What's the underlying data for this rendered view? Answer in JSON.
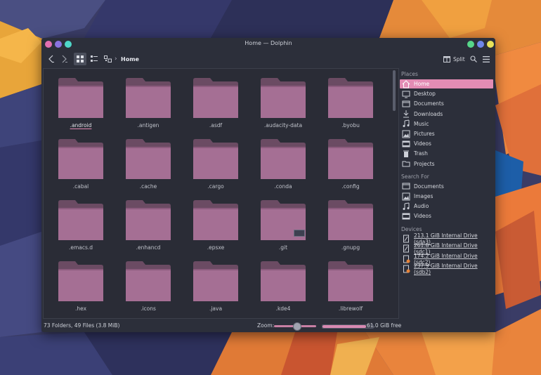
{
  "window": {
    "title": "Home — Dolphin"
  },
  "titlebar": {
    "left_buttons": [
      "#e26fb0",
      "#8a72e0",
      "#4fd6c8"
    ],
    "right_buttons": [
      "#57d68a",
      "#6f86ea",
      "#e8e25a"
    ]
  },
  "toolbar": {
    "back_icon": "chevron-left-icon",
    "forward_icon": "chevron-right-icon",
    "view_modes": [
      "icons-view-icon",
      "compact-view-icon",
      "details-view-icon"
    ],
    "breadcrumb": "Home",
    "split_label": "Split",
    "search_icon": "search-icon",
    "menu_icon": "hamburger-menu-icon"
  },
  "folders": [
    {
      "name": ".android",
      "current": true
    },
    {
      "name": ".antigen"
    },
    {
      "name": ".asdf"
    },
    {
      "name": ".audacity-data"
    },
    {
      "name": ".byobu"
    },
    {
      "name": ".cabal"
    },
    {
      "name": ".cache"
    },
    {
      "name": ".cargo"
    },
    {
      "name": ".conda"
    },
    {
      "name": ".config"
    },
    {
      "name": ".emacs.d"
    },
    {
      "name": ".enhancd"
    },
    {
      "name": ".epsxe"
    },
    {
      "name": ".git",
      "badge": true
    },
    {
      "name": ".gnupg"
    },
    {
      "name": ".hex"
    },
    {
      "name": ".icons"
    },
    {
      "name": ".java"
    },
    {
      "name": ".kde4"
    },
    {
      "name": ".librewolf"
    }
  ],
  "statusbar": {
    "summary": "73 Folders, 49 Files (3.8 MiB)",
    "zoom_label": "Zoom:",
    "free_space": "61.0 GiB free",
    "used_fraction": 0.86
  },
  "places": {
    "header": "Places",
    "items": [
      {
        "label": "Home",
        "icon": "home-icon",
        "selected": true
      },
      {
        "label": "Desktop",
        "icon": "desktop-icon"
      },
      {
        "label": "Documents",
        "icon": "documents-icon"
      },
      {
        "label": "Downloads",
        "icon": "downloads-icon"
      },
      {
        "label": "Music",
        "icon": "music-icon"
      },
      {
        "label": "Pictures",
        "icon": "pictures-icon"
      },
      {
        "label": "Videos",
        "icon": "videos-icon"
      },
      {
        "label": "Trash",
        "icon": "trash-icon"
      },
      {
        "label": "Projects",
        "icon": "folder-icon"
      }
    ]
  },
  "search_for": {
    "header": "Search For",
    "items": [
      {
        "label": "Documents",
        "icon": "documents-icon"
      },
      {
        "label": "Images",
        "icon": "pictures-icon"
      },
      {
        "label": "Audio",
        "icon": "music-icon"
      },
      {
        "label": "Videos",
        "icon": "videos-icon"
      }
    ]
  },
  "devices": {
    "header": "Devices",
    "items": [
      {
        "label": "213.1 GiB Internal Drive (sda3)",
        "icon": "drive-icon"
      },
      {
        "label": "261.8 GiB Internal Drive (sdc1)",
        "icon": "drive-icon"
      },
      {
        "label": "174.2 GiB Internal Drive (sdc2)",
        "icon": "drive-warning-icon"
      },
      {
        "label": "237.9 GiB Internal Drive (sdb2)",
        "icon": "drive-warning-icon"
      }
    ]
  },
  "colors": {
    "accent": "#e38cb4",
    "folder_body": "#a56f94",
    "folder_tab": "#6b4b63"
  }
}
